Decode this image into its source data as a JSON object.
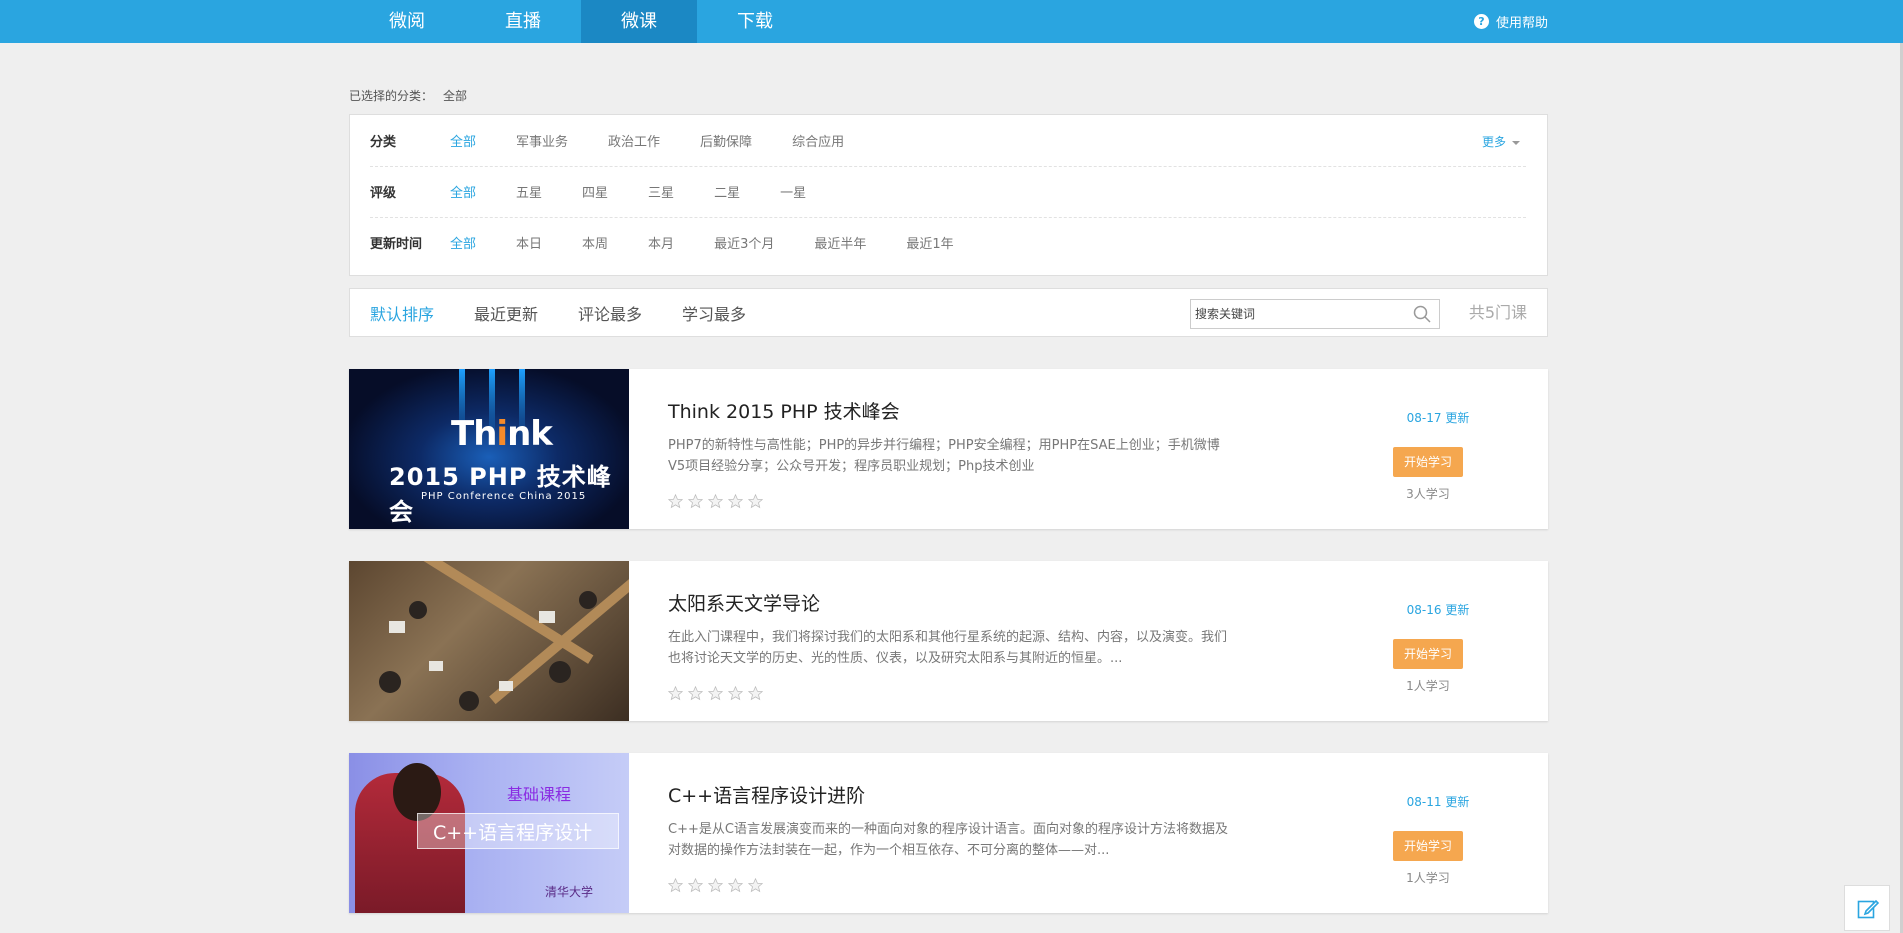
{
  "nav": {
    "items": [
      "微阅",
      "直播",
      "微课",
      "下载"
    ],
    "active_index": 2,
    "help": "使用帮助"
  },
  "selected": {
    "label": "已选择的分类：",
    "value": "全部"
  },
  "filters": {
    "category": {
      "label": "分类",
      "options": [
        "全部",
        "军事业务",
        "政治工作",
        "后勤保障",
        "综合应用"
      ]
    },
    "rating": {
      "label": "评级",
      "options": [
        "全部",
        "五星",
        "四星",
        "三星",
        "二星",
        "一星"
      ]
    },
    "update_time": {
      "label": "更新时间",
      "options": [
        "全部",
        "本日",
        "本周",
        "本月",
        "最近3个月",
        "最近半年",
        "最近1年"
      ]
    },
    "more": "更多"
  },
  "sort": {
    "options": [
      "默认排序",
      "最近更新",
      "评论最多",
      "学习最多"
    ],
    "search_placeholder": "搜索关键词",
    "total": "共5门课"
  },
  "thumb_text": {
    "think_prefix": "Th",
    "think_accent": "i",
    "think_suffix": "nk",
    "php_main": "2015 PHP 技术峰会",
    "php_sub": "PHP  Conference  China  2015",
    "cpp_course_type": "基础课程",
    "cpp_box": "C++语言程序设计",
    "cpp_logo": "清华大学"
  },
  "courses": [
    {
      "title": "Think 2015 PHP 技术峰会",
      "desc": "PHP7的新特性与高性能；PHP的异步并行编程；PHP安全编程；用PHP在SAE上创业；手机微博V5项目经验分享；公众号开发；程序员职业规划；Php技术创业",
      "update": "08-17 更新",
      "button": "开始学习",
      "learners": "3人学习"
    },
    {
      "title": "太阳系天文学导论",
      "desc": "在此入门课程中，我们将探讨我们的太阳系和其他行星系统的起源、结构、内容，以及演变。我们也将讨论天文学的历史、光的性质、仪表，以及研究太阳系与其附近的恒星。...",
      "update": "08-16 更新",
      "button": "开始学习",
      "learners": "1人学习"
    },
    {
      "title": "C++语言程序设计进阶",
      "desc": "C++是从C语言发展演变而来的一种面向对象的程序设计语言。面向对象的程序设计方法将数据及对数据的操作方法封装在一起，作为一个相互依存、不可分离的整体——对...",
      "update": "08-11 更新",
      "button": "开始学习",
      "learners": "1人学习"
    }
  ],
  "colors": {
    "accent": "#2aa5e0",
    "button": "#f5a74f"
  }
}
